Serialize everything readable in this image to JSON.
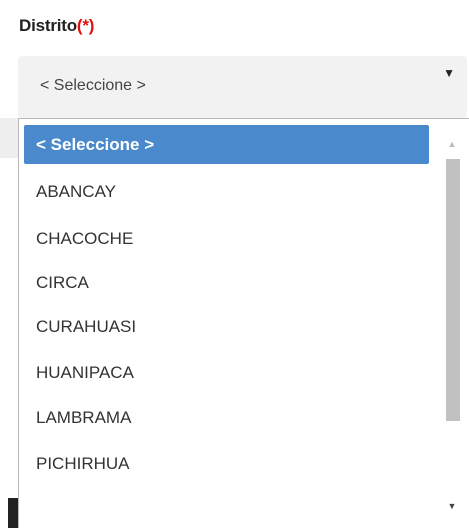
{
  "field": {
    "label": "Distrito",
    "required_marker": "(*)",
    "selected_value": "< Seleccione >",
    "caret": "▼"
  },
  "dropdown": {
    "options": [
      "< Seleccione >",
      "ABANCAY",
      "CHACOCHE",
      "CIRCA",
      "CURAHUASI",
      "HUANIPACA",
      "LAMBRAMA",
      "PICHIRHUA"
    ],
    "highlighted_index": 0,
    "scroll_up": "▲",
    "scroll_down": "▼"
  },
  "colors": {
    "highlight": "#4a89cc",
    "required": "#e01010",
    "scroll_thumb": "#c1c1c1"
  }
}
